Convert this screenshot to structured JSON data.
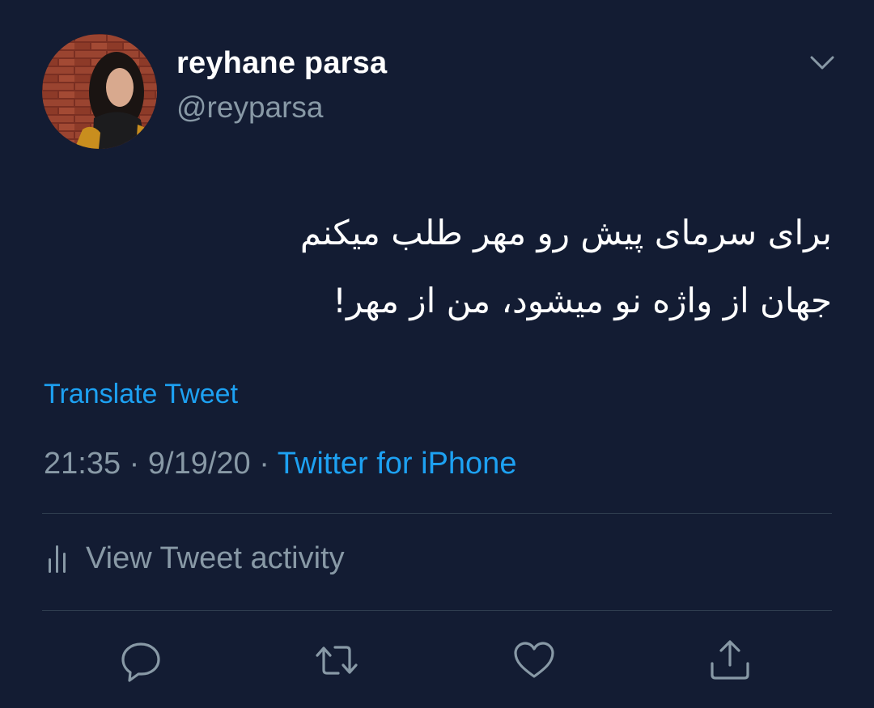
{
  "tweet": {
    "author": {
      "display_name": "reyhane parsa",
      "handle": "@reyparsa"
    },
    "text_lines": [
      "برای سرمای پیش رو مهر طلب میکنم",
      "جهان از واژه نو میشود، من از مهر!"
    ],
    "translate_label": "Translate Tweet",
    "time": "21:35",
    "separator": "·",
    "date": "9/19/20",
    "source": "Twitter for iPhone",
    "activity_label": "View Tweet activity"
  },
  "icons": {
    "menu": "chevron-down-icon",
    "activity": "bar-chart-icon",
    "reply": "reply-icon",
    "retweet": "retweet-icon",
    "like": "heart-icon",
    "share": "share-icon"
  },
  "colors": {
    "background": "#131c33",
    "primary_text": "#ffffff",
    "secondary_text": "#8899a6",
    "accent": "#1da1f2",
    "divider": "#2f3d4f"
  }
}
